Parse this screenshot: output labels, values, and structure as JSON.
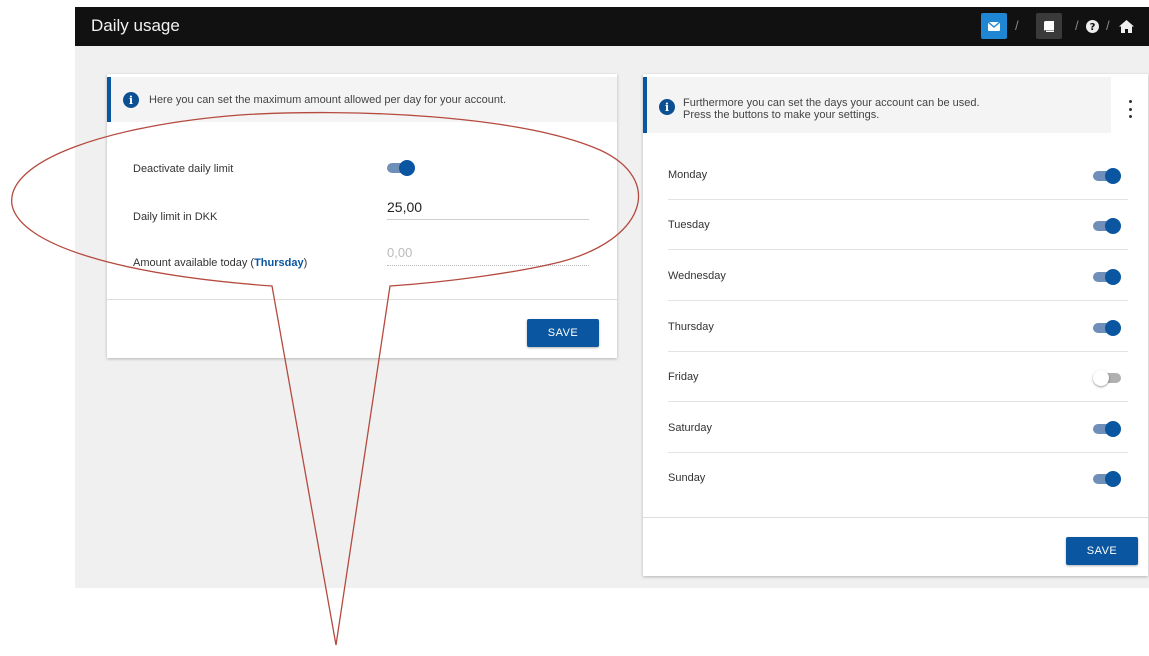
{
  "header": {
    "title": "Daily usage",
    "separator": "/"
  },
  "icons": {
    "mail": "envelope-icon",
    "book": "book-icon",
    "help": "question-circle-icon",
    "home": "home-icon",
    "info": "info-icon"
  },
  "colors": {
    "accent": "#0a56a0",
    "topbar": "#111111",
    "mail_button": "#1f86d4"
  },
  "daily_limit": {
    "info": "Here you can set the maximum amount allowed per day for your account.",
    "deactivate_label": "Deactivate daily limit",
    "deactivate_on": true,
    "limit_label": "Daily limit in DKK",
    "limit_value": "25,00",
    "available_label": "Amount available today (",
    "available_day": "Thursday",
    "available_close": ")",
    "available_value": "0,00",
    "save_label": "SAVE"
  },
  "days": {
    "info_line1": "Furthermore you can set the days your account can be used.",
    "info_line2": "Press the buttons to make your settings.",
    "items": [
      {
        "label": "Monday",
        "enabled": true
      },
      {
        "label": "Tuesday",
        "enabled": true
      },
      {
        "label": "Wednesday",
        "enabled": true
      },
      {
        "label": "Thursday",
        "enabled": true
      },
      {
        "label": "Friday",
        "enabled": false
      },
      {
        "label": "Saturday",
        "enabled": true
      },
      {
        "label": "Sunday",
        "enabled": true
      }
    ],
    "save_label": "SAVE"
  }
}
